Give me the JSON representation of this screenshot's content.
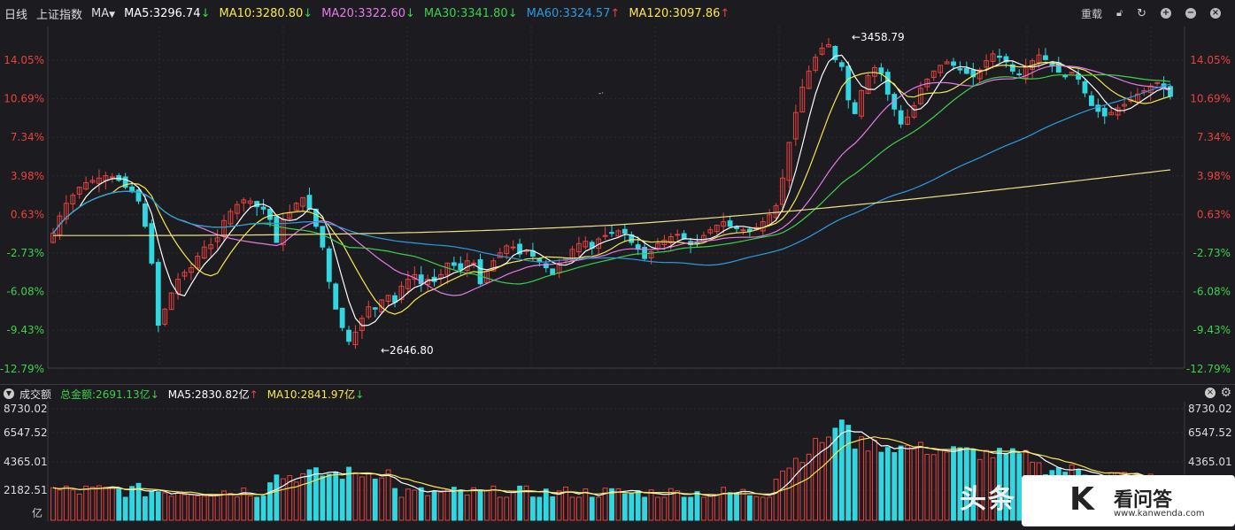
{
  "header": {
    "period": "日线",
    "index_name": "上证指数",
    "indicator": "MA",
    "ma5": "MA5:3296.74",
    "ma10": "MA10:3280.80",
    "ma20": "MA20:3322.60",
    "ma30": "MA30:3341.80",
    "ma60": "MA60:3324.57",
    "ma120": "MA120:3097.86",
    "reload": "重载"
  },
  "colors": {
    "up": "#e8413e",
    "down": "#30d6e0",
    "ma5": "#ffffff",
    "ma10": "#f6e84a",
    "ma20": "#e47ae8",
    "ma30": "#3bd14a",
    "ma60": "#2c9ae0",
    "ma120": "#e8e08a",
    "ma_label_ma5": "#ffffff",
    "ma_label_ma10": "#f6e84a",
    "ma_label_ma20": "#e47ae8",
    "ma_label_ma30": "#3bd14a",
    "ma_label_ma60": "#2c9ae0",
    "ma_label_ma120": "#f6e84a"
  },
  "price_axis": {
    "left_labels": [
      "14.05%",
      "10.69%",
      "7.34%",
      "3.98%",
      "0.63%",
      "-2.73%",
      "-6.08%",
      "-9.43%",
      "-12.79%"
    ],
    "right_labels": [
      "14.05%",
      "10.69%",
      "7.34%",
      "3.98%",
      "0.63%",
      "-2.73%",
      "-6.08%",
      "-9.43%",
      "-12.79%"
    ]
  },
  "annotations": {
    "high": "←3458.79",
    "low": "←2646.80"
  },
  "volume_header": {
    "title": "成交额",
    "total": "总金额:2691.13亿",
    "ma5": "MA5:2830.82亿",
    "ma10": "MA10:2841.97亿"
  },
  "volume_axis": {
    "labels": [
      "8730.02",
      "6547.52",
      "4365.01",
      "2182.51"
    ],
    "right_labels": [
      "8730.02",
      "6547.52",
      "4365.01",
      "2182.51"
    ],
    "unit": "亿"
  },
  "watermark": {
    "text1": "头条",
    "text2": "看问答",
    "url": "www.kanwenda.com"
  },
  "chart_data": {
    "type": "candlestick",
    "percent_range": [
      -12.79,
      14.05
    ],
    "candles_close_pct": [
      -1.0,
      0.5,
      1.6,
      2.3,
      3.0,
      3.4,
      3.6,
      3.8,
      4.0,
      3.9,
      3.6,
      3.0,
      2.6,
      1.8,
      -0.4,
      -3.6,
      -9.0,
      -7.6,
      -6.2,
      -5.0,
      -4.4,
      -4.0,
      -3.0,
      -2.2,
      -2.0,
      -1.4,
      0.1,
      0.9,
      1.5,
      1.9,
      1.8,
      1.3,
      1.1,
      0.2,
      -1.8,
      0.2,
      0.8,
      1.6,
      2.1,
      1.1,
      -0.4,
      -2.2,
      -5.2,
      -7.6,
      -9.2,
      -10.4,
      -9.6,
      -8.4,
      -7.4,
      -7.6,
      -6.8,
      -6.4,
      -7.0,
      -5.6,
      -5.0,
      -4.6,
      -5.4,
      -5.0,
      -5.2,
      -4.6,
      -3.6,
      -3.8,
      -4.2,
      -3.4,
      -3.6,
      -5.4,
      -4.3,
      -3.4,
      -2.7,
      -2.1,
      -2.2,
      -2.8,
      -2.5,
      -3.0,
      -3.5,
      -4.0,
      -4.6,
      -3.6,
      -3.2,
      -2.4,
      -1.9,
      -1.7,
      -2.3,
      -1.5,
      -1.2,
      -1.0,
      -0.8,
      -1.0,
      -1.8,
      -2.4,
      -3.2,
      -2.6,
      -1.9,
      -1.6,
      -1.3,
      -1.1,
      -1.5,
      -2.0,
      -1.9,
      -1.2,
      -0.7,
      -0.3,
      0.0,
      -0.4,
      -0.6,
      -0.7,
      -0.8,
      -0.5,
      0.0,
      0.6,
      1.4,
      3.8,
      6.9,
      9.5,
      11.7,
      13.1,
      14.3,
      15.1,
      15.4,
      14.1,
      13.5,
      10.6,
      9.4,
      11.4,
      12.7,
      13.4,
      12.9,
      11.1,
      9.8,
      8.5,
      9.1,
      10.1,
      11.6,
      12.4,
      13.1,
      13.6,
      13.9,
      13.6,
      13.2,
      12.9,
      12.6,
      13.2,
      14.0,
      14.6,
      14.3,
      13.9,
      13.1,
      12.8,
      13.4,
      14.0,
      14.5,
      14.1,
      13.6,
      13.0,
      12.6,
      13.0,
      12.4,
      11.2,
      10.1,
      9.6,
      9.2,
      9.5,
      9.9,
      10.2,
      10.6,
      11.1,
      11.4,
      11.8,
      12.1,
      11.6,
      10.9
    ]
  }
}
